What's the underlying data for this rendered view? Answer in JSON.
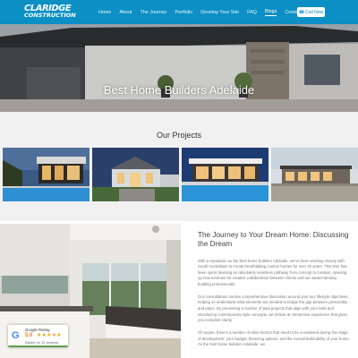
{
  "header": {
    "logo_line1": "CLARIDGE",
    "logo_line2": "CONSTRUCTION",
    "nav": [
      "Home",
      "About",
      "The Journey",
      "Portfolio",
      "Develop Your Site",
      "FAQ",
      "Blogs",
      "Contact"
    ],
    "active_nav": "Blogs",
    "call_label": "Call Now",
    "brand_color": "#0c8fc4"
  },
  "hero": {
    "title": "Best Home Builders Adelaide"
  },
  "projects": {
    "title": "Our Projects",
    "thumbnails": [
      "project-1",
      "project-2",
      "project-3",
      "project-4"
    ]
  },
  "article": {
    "heading": "The Journey to Your Dream Home: Discussing the Dream",
    "paragraphs": [
      "With a reputation as the best home builders Adelaide, we've been working closely with South Australians to create breathtaking custom homes for over 30 years. This time has been spent devising an absolutely seamless pathway from concept to creation, opening up new avenues for creative collaboration between clients and our award-winning building professionals.",
      "Our consultations involve comprehensive discussion around your key lifestyle objectives, helping us understand what elements are needed to bridge the gap between personality and place. By presenting a number of past projects that align with your brief and introducing contemporary style concepts, we deliver an immersive experience that gives you complete clarity.",
      "Of course, there's a number of other factors that need to be considered during this stage of development: your budget, financing options, and the overall build-ability of your home. As the best home builders Adelaide, we"
    ]
  },
  "rating": {
    "label": "Google Rating",
    "score": "5.0",
    "stars": "★★★★★",
    "based_on": "Based on 12 reviews"
  }
}
